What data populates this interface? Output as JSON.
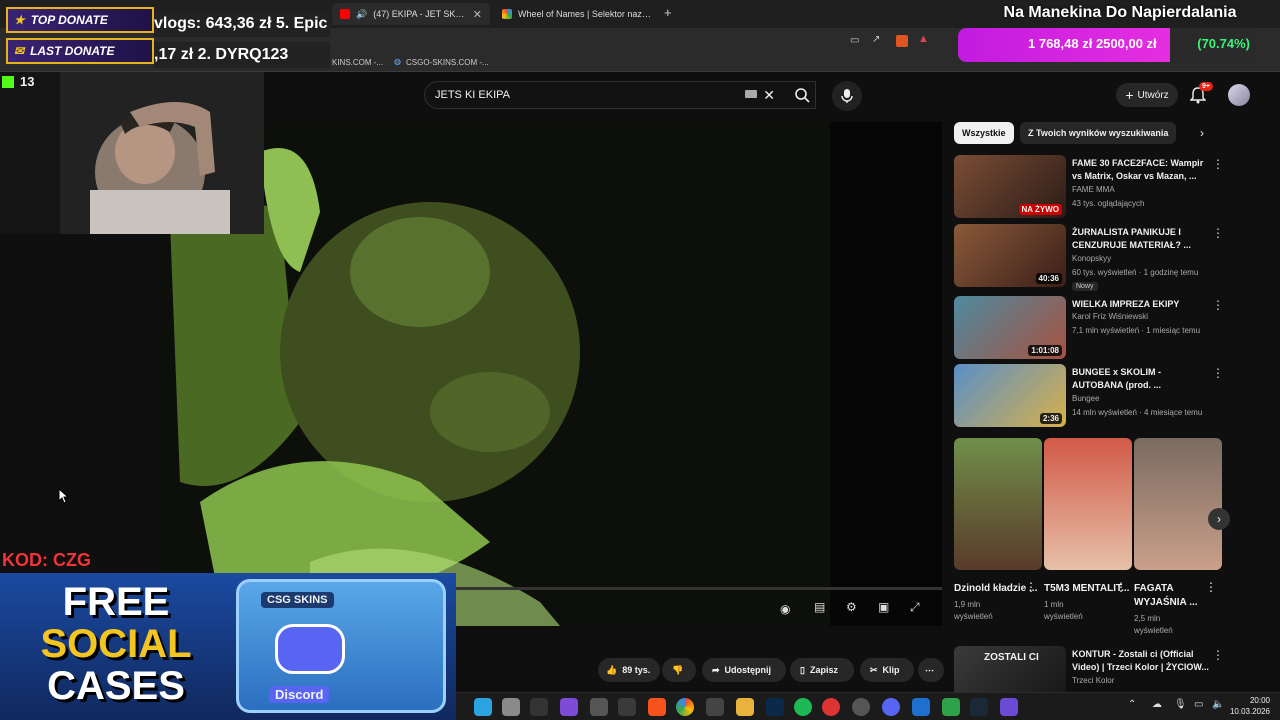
{
  "browser": {
    "tabs": [
      {
        "label": "(47) EKIPA - JET SKI (Kostek, J...",
        "favicon_color": "#ff0000"
      },
      {
        "label": "Wheel of Names | Selektor nazw losowych",
        "favicon_color": "#4285f4"
      }
    ],
    "new_tab_icon": "plus-icon",
    "bookmarks": [
      "KINS.COM -...",
      "CSGO-SKINS.COM -..."
    ]
  },
  "youtube": {
    "search_query": "JETS KI EKIPA",
    "create_label": "Utwórz",
    "notif_count": "9+",
    "chips": [
      "Wszystkie",
      "Z Twoich wyników wyszukiwania"
    ],
    "recommendations": [
      {
        "title": "FAME 30 FACE2FACE: Wampir vs Matrix, Oskar vs Mazan, ...",
        "channel": "FAME MMA",
        "meta": "43 tys. oglądających",
        "badge": "NA ŻYWO",
        "thumb_color": "#5a3b2f"
      },
      {
        "title": "ŻURNALISTA PANIKUJE I CENZURUJE MATERIAŁ? ...",
        "channel": "Konopskyy",
        "meta": "60 tys. wyświetleń · 1 godzinę temu",
        "badge": "40:36",
        "new_label": "Nowy",
        "thumb_color": "#6a3b2a"
      },
      {
        "title": "WIELKA IMPREZA EKIPY",
        "channel": "Karol Friz Wiśniewski",
        "meta": "7,1 mln wyświetleń · 1 miesiąc temu",
        "badge": "1:01:08",
        "thumb_color": "#3f6a7d"
      },
      {
        "title": "BUNGEE x SKOLIM - AUTOBANA (prod. ...",
        "channel": "Bungee",
        "meta": "14 mln wyświetleń · 4 miesiące temu",
        "badge": "2:36",
        "thumb_color": "#4c7ab0"
      }
    ],
    "shorts": [
      {
        "title": "Dzinold kładzie ...",
        "meta1": "1,9 mln",
        "meta2": "wyświetleń",
        "color": "#6b7b45"
      },
      {
        "title": "T5M3 MENTALIT...",
        "meta1": "1 mln",
        "meta2": "wyświetleń",
        "color": "#c8503f"
      },
      {
        "title": "FAGATA WYJAŚNIA ...",
        "meta1": "2,5 mln",
        "meta2": "wyświetleń",
        "color": "#8a7466"
      }
    ],
    "next_rec": {
      "title": "KONTUR - Zostali ci (Official Video) | Trzeci Kolor | ŻYCIOW...",
      "channel": "Trzeci Kolor",
      "thumb_text": "ZOSTALI CI"
    },
    "actions": {
      "likes": "89 tys.",
      "share": "Udostępnij",
      "save": "Zapisz",
      "clip": "Klip"
    }
  },
  "overlay": {
    "top_donate_label": "TOP DONATE",
    "top_donate_value": "vlogs: 643,36 zł  5. Epic",
    "last_donate_label": "LAST DONATE",
    "last_donate_value": ",17 zł  2. DYRQ123",
    "goal_title": "Na Manekina Do Napierdalania",
    "goal_progress": "1 768,48 zł 2500,00 zł",
    "goal_percent": "(70.74%)",
    "goal_fraction": 0.7074,
    "viewer_count": "13",
    "code": "KOD: CZG",
    "promo_line1": "FREE",
    "promo_line2": "SOCIAL",
    "promo_line3": "CASES",
    "promo_brand": "CSG SKINS",
    "promo_discord": "Discord"
  },
  "taskbar": {
    "time": "20:00",
    "date": "10.03.2026"
  }
}
